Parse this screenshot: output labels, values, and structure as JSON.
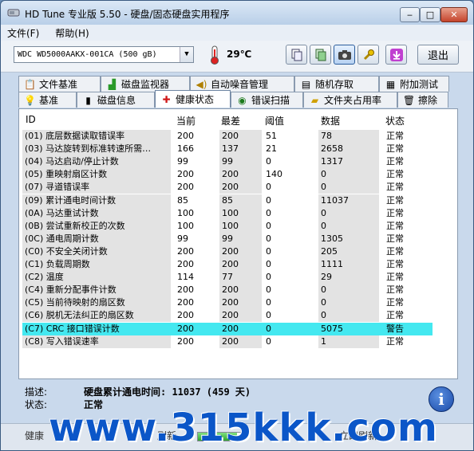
{
  "window": {
    "title": "HD Tune 专业版 5.50 - 硬盘/固态硬盘实用程序",
    "min_label": "‒",
    "max_label": "□",
    "close_label": "✕"
  },
  "menu": {
    "file": "文件(F)",
    "help": "帮助(H)"
  },
  "toolbar": {
    "drive": "WDC    WD5000AAKX-001CA (500 gB)",
    "temperature": "29℃",
    "exit_label": "退出",
    "icons": [
      "copy-text-icon",
      "copy-screen-icon",
      "camera-icon",
      "wrench-icon",
      "download-icon"
    ]
  },
  "tabs_top": [
    {
      "label": "文件基准",
      "icon": "file-benchmark-icon"
    },
    {
      "label": "磁盘监视器",
      "icon": "disk-monitor-icon"
    },
    {
      "label": "自动噪音管理",
      "icon": "speaker-icon"
    },
    {
      "label": "随机存取",
      "icon": "random-access-icon"
    },
    {
      "label": "附加测试",
      "icon": "extra-tests-icon"
    }
  ],
  "tabs_bottom": [
    {
      "label": "基准",
      "icon": "benchmark-icon"
    },
    {
      "label": "磁盘信息",
      "icon": "disk-info-icon"
    },
    {
      "label": "健康状态",
      "icon": "health-cross-icon",
      "active": true
    },
    {
      "label": "错误扫描",
      "icon": "error-scan-icon"
    },
    {
      "label": "文件夹占用率",
      "icon": "folder-icon"
    },
    {
      "label": "擦除",
      "icon": "trash-icon"
    }
  ],
  "table": {
    "headers": [
      "ID",
      "当前",
      "最差",
      "阈值",
      "数据",
      "状态"
    ],
    "rows": [
      {
        "id": "(01) 底层数据读取错误率",
        "cur": "200",
        "worst": "200",
        "thr": "51",
        "data": "78",
        "status": "正常"
      },
      {
        "id": "(03) 马达旋转到标准转速所需…",
        "cur": "166",
        "worst": "137",
        "thr": "21",
        "data": "2658",
        "status": "正常"
      },
      {
        "id": "(04) 马达启动/停止计数",
        "cur": "99",
        "worst": "99",
        "thr": "0",
        "data": "1317",
        "status": "正常"
      },
      {
        "id": "(05) 重映射扇区计数",
        "cur": "200",
        "worst": "200",
        "thr": "140",
        "data": "0",
        "status": "正常"
      },
      {
        "id": "(07) 寻道错误率",
        "cur": "200",
        "worst": "200",
        "thr": "0",
        "data": "0",
        "status": "正常"
      },
      {
        "id": "(09) 累计通电时间计数",
        "cur": "85",
        "worst": "85",
        "thr": "0",
        "data": "11037",
        "status": "正常"
      },
      {
        "id": "(0A) 马达重试计数",
        "cur": "100",
        "worst": "100",
        "thr": "0",
        "data": "0",
        "status": "正常"
      },
      {
        "id": "(0B) 尝试重新校正的次数",
        "cur": "100",
        "worst": "100",
        "thr": "0",
        "data": "0",
        "status": "正常"
      },
      {
        "id": "(0C) 通电周期计数",
        "cur": "99",
        "worst": "99",
        "thr": "0",
        "data": "1305",
        "status": "正常"
      },
      {
        "id": "(C0) 不安全关闭计数",
        "cur": "200",
        "worst": "200",
        "thr": "0",
        "data": "205",
        "status": "正常"
      },
      {
        "id": "(C1) 负载周期数",
        "cur": "200",
        "worst": "200",
        "thr": "0",
        "data": "1111",
        "status": "正常"
      },
      {
        "id": "(C2) 温度",
        "cur": "114",
        "worst": "77",
        "thr": "0",
        "data": "29",
        "status": "正常"
      },
      {
        "id": "(C4) 重新分配事件计数",
        "cur": "200",
        "worst": "200",
        "thr": "0",
        "data": "0",
        "status": "正常"
      },
      {
        "id": "(C5) 当前待映射的扇区数",
        "cur": "200",
        "worst": "200",
        "thr": "0",
        "data": "0",
        "status": "正常"
      },
      {
        "id": "(C6) 脱机无法纠正的扇区数",
        "cur": "200",
        "worst": "200",
        "thr": "0",
        "data": "0",
        "status": "正常"
      },
      {
        "id": "(C7) CRC 接口错误计数",
        "cur": "200",
        "worst": "200",
        "thr": "0",
        "data": "5075",
        "status": "警告",
        "warning": true
      },
      {
        "id": "(C8) 写入错误速率",
        "cur": "200",
        "worst": "200",
        "thr": "0",
        "data": "1",
        "status": "正常"
      }
    ]
  },
  "details": {
    "desc_label": "描述:",
    "desc_value": "硬盘累计通电时间: 11037 (459 天)",
    "state_label": "状态:",
    "state_value": "正常"
  },
  "statusbar": {
    "left": "健康",
    "middle": "刷新",
    "right": "立即刷新",
    "progress": 0.85
  },
  "watermark": "www.315kkk.com",
  "colors": {
    "warning_row": "#44e8f0",
    "title_bar": "#c9d9ec"
  }
}
